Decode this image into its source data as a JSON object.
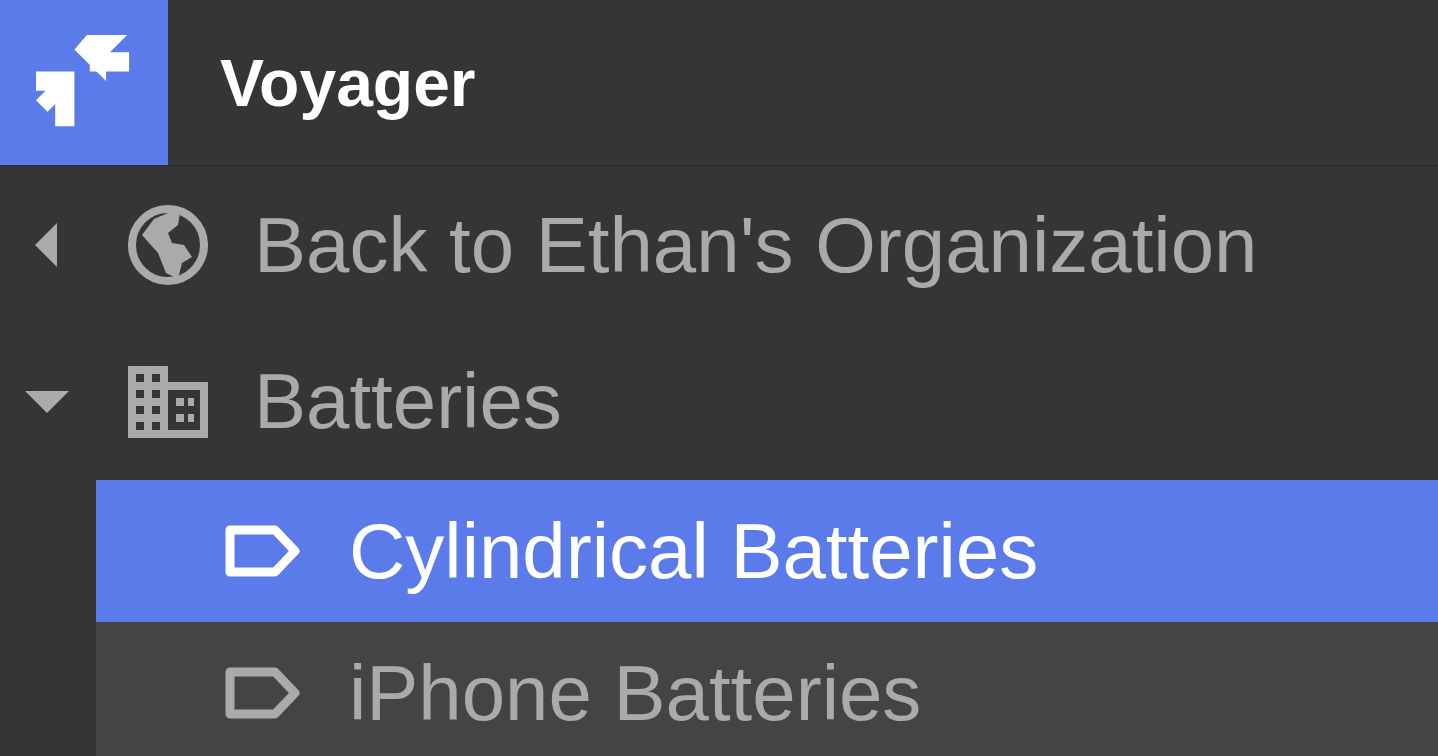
{
  "app": {
    "title": "Voyager"
  },
  "back_link": {
    "label": "Back to Ethan's Organization"
  },
  "tree": [
    {
      "label": "Batteries",
      "expanded": true,
      "selected": false,
      "children": [
        {
          "label": "Cylindrical Batteries",
          "selected": true
        },
        {
          "label": "iPhone Batteries",
          "selected": false
        }
      ]
    }
  ]
}
